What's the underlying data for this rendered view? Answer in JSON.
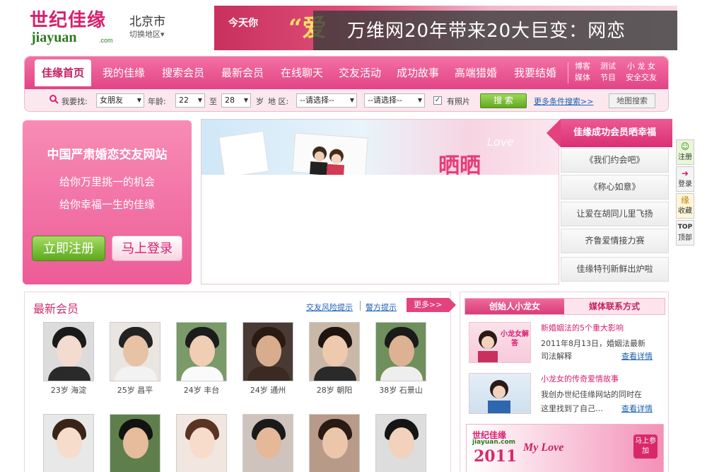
{
  "header": {
    "logo_cn": "世纪佳缘",
    "logo_en": "jiayuan",
    "logo_com": ".com",
    "city": "北京市",
    "city_switch": "切换地区▾",
    "banner_tagline": "今天你",
    "banner_ai": "“爱",
    "banner_overlay": "万维网20年带来20大巨变：网恋"
  },
  "nav": {
    "items": [
      {
        "label": "佳缘首页"
      },
      {
        "label": "我的佳缘"
      },
      {
        "label": "搜索会员"
      },
      {
        "label": "最新会员"
      },
      {
        "label": "在线聊天"
      },
      {
        "label": "交友活动"
      },
      {
        "label": "成功故事"
      },
      {
        "label": "高端猎婚"
      },
      {
        "label": "我要结婚"
      }
    ],
    "small": [
      {
        "l1": "博客",
        "l2": "媒体"
      },
      {
        "l1": "测试",
        "l2": "节目"
      },
      {
        "l1": "小 龙 女",
        "l2": "安全交友"
      }
    ]
  },
  "search": {
    "find_label": "我要找:",
    "find_value": "女朋友",
    "age_label": "年龄:",
    "age_from": "22",
    "to_label": "至",
    "age_to": "28",
    "unit_label": "岁",
    "area_label": "地 区:",
    "area1": "--请选择--",
    "area2": "--请选择--",
    "photo_label": "有照片",
    "photo_check": "✓",
    "search_btn": "搜 索",
    "more_link": "更多条件搜索>>",
    "map_btn": "地图搜索"
  },
  "promo": {
    "title": "中国严肃婚恋交友网站",
    "line1": "给你万里挑一的机会",
    "line2": "给你幸福一生的佳缘",
    "register": "立即注册",
    "login": "马上登录"
  },
  "center": {
    "deco": "晒晒",
    "love": "Love"
  },
  "success": {
    "header": "佳缘成功会员晒幸福",
    "items": [
      {
        "label": "《我们约会吧》"
      },
      {
        "label": "《称心如意》"
      },
      {
        "label": "让爱在胡同儿里飞扬"
      },
      {
        "label": "齐鲁爱情接力赛"
      },
      {
        "label": "佳缘特刊新鲜出炉啦"
      }
    ]
  },
  "side": {
    "items": [
      {
        "icon": "☺",
        "label": "注册"
      },
      {
        "icon": "➜",
        "label": "登录"
      },
      {
        "icon": "缘",
        "label": "收藏"
      },
      {
        "icon": "TOP",
        "label": "顶部"
      }
    ]
  },
  "members": {
    "title": "最新会员",
    "link1": "交友风险提示",
    "link2": "警方提示",
    "more": "更多>>",
    "row1": [
      {
        "caption": "23岁  海淀"
      },
      {
        "caption": "25岁  昌平"
      },
      {
        "caption": "24岁  丰台"
      },
      {
        "caption": "24岁  通州"
      },
      {
        "caption": "28岁  朝阳"
      },
      {
        "caption": "38岁  石景山"
      }
    ]
  },
  "founder": {
    "tab1": "创始人小龙女",
    "tab2": "媒体联系方式",
    "badge": "小龙女解答",
    "item1": {
      "title": "新婚姻法的5个重大影响",
      "line1": "2011年8月13日，婚姻法最新",
      "line2": "司法解释",
      "link": "查看详情"
    },
    "item2": {
      "title": "小龙女的传奇爱情故事",
      "line1": "我创办世纪佳缘网站的同时在",
      "line2": "这里找到了自己…",
      "link": "查看详情"
    },
    "banner": {
      "logo_cn": "世纪佳缘",
      "logo_en": "jiayuan.com",
      "year": "2011",
      "slogan": "My Love",
      "badge": "马上参加"
    }
  },
  "colors": {
    "brand_pink": "#e24486",
    "brand_green": "#2d7a1f",
    "link_blue": "#1b5fb0"
  }
}
